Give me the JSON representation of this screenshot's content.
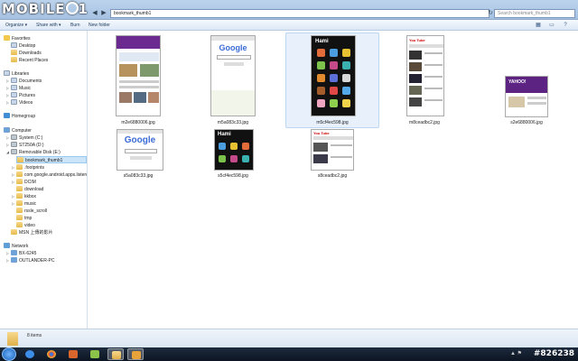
{
  "watermark": {
    "text": "MOBILE",
    "suffix": "1"
  },
  "address": {
    "path": "bookmark_thumb1"
  },
  "search": {
    "placeholder": "Search bookmark_thumb1"
  },
  "toolbar": {
    "organize": "Organize ▾",
    "share": "Share with ▾",
    "burn": "Burn",
    "new_folder": "New folder"
  },
  "sidebar": {
    "favorites": {
      "label": "Favorites",
      "items": [
        "Desktop",
        "Downloads",
        "Recent Places"
      ]
    },
    "libraries": {
      "label": "Libraries",
      "items": [
        "Documents",
        "Music",
        "Pictures",
        "Videos"
      ]
    },
    "homegroup": "Homegroup",
    "computer": {
      "label": "Computer",
      "items": [
        "System (C:)",
        "ST250A (D:)",
        "Removable Disk (E:)"
      ]
    },
    "folders": [
      "bookmark_thumb1",
      ".footprints",
      "com.google.android.apps.listen",
      "DCIM",
      "download",
      "kkbox",
      "music",
      "rssle_scroll",
      "tmp",
      "video"
    ],
    "msn": "MSN 上傳的影片",
    "network": {
      "label": "Network",
      "items": [
        "BX-6245",
        "OUTLANDER-PC"
      ]
    }
  },
  "files": [
    {
      "name": "m2e6880006.jpg",
      "theme": "yahoo"
    },
    {
      "name": "m5a083c33.jpg",
      "theme": "google"
    },
    {
      "name": "m5cf4ec598.jpg",
      "theme": "hami",
      "selected": true
    },
    {
      "name": "m8ceadbc2.jpg",
      "theme": "youtube"
    },
    {
      "name": "s2e6880006.jpg",
      "theme": "yahoo-small"
    },
    {
      "name": "s5a083c33.jpg",
      "theme": "google-small"
    },
    {
      "name": "s5cf4ec598.jpg",
      "theme": "hami-small"
    },
    {
      "name": "s8ceadbc2.jpg",
      "theme": "youtube-small"
    }
  ],
  "thumb_text": {
    "google": "Google",
    "hami": "Hami",
    "yahoo": "YAHOO!",
    "youtube": "You Tube"
  },
  "status": {
    "count": "8 items"
  },
  "taskbar": {
    "clock": "#826238"
  },
  "colors": {
    "accent": "#1e395b",
    "selection": "#cce4f7",
    "taskbar": "#0c1522"
  }
}
